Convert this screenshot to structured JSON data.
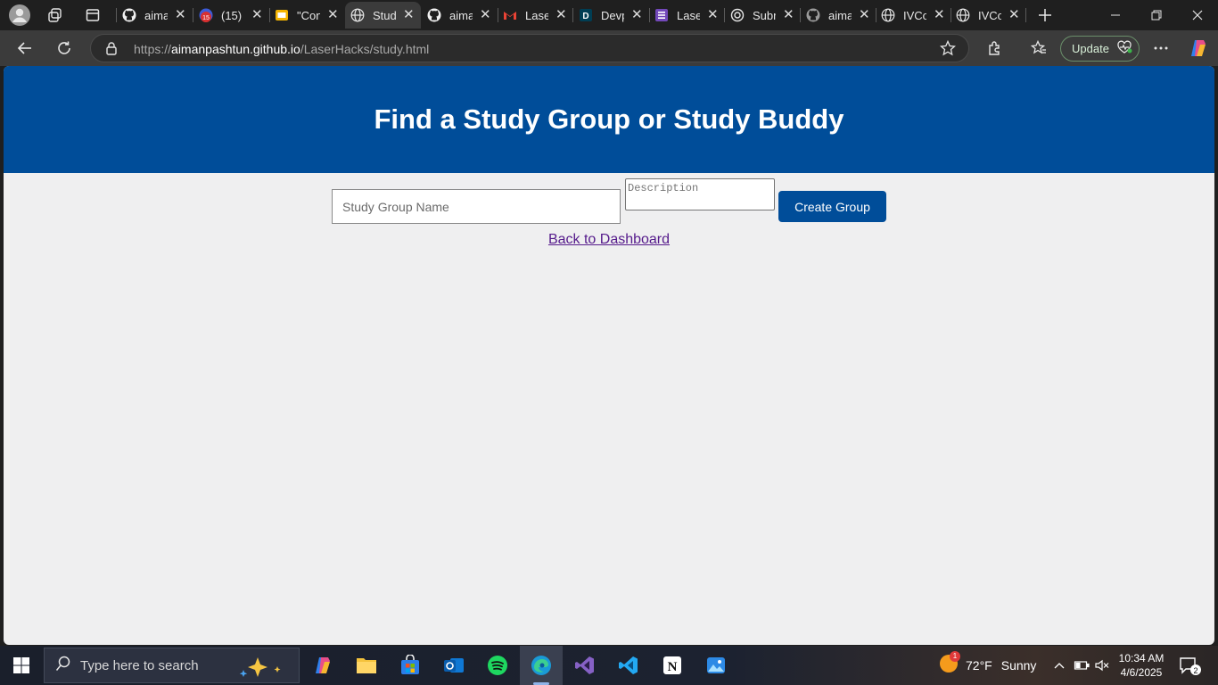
{
  "tabs": [
    {
      "title": "aiman",
      "icon": "github-icon"
    },
    {
      "title": "(15)",
      "icon": "notification-badge-icon",
      "badge": "15"
    },
    {
      "title": "\"Con",
      "icon": "slides-icon"
    },
    {
      "title": "Stud",
      "icon": "globe-icon",
      "active": true
    },
    {
      "title": "aiman",
      "icon": "github-icon"
    },
    {
      "title": "Laser",
      "icon": "gmail-icon"
    },
    {
      "title": "Devp",
      "icon": "devpost-icon"
    },
    {
      "title": "Laser",
      "icon": "forms-icon"
    },
    {
      "title": "Subr",
      "icon": "openai-icon"
    },
    {
      "title": "aiman",
      "icon": "github-icon"
    },
    {
      "title": "IVCo",
      "icon": "globe-icon"
    },
    {
      "title": "IVCo",
      "icon": "globe-icon"
    }
  ],
  "address": {
    "scheme": "https://",
    "domain": "aimanpashtun.github.io",
    "path": "/LaserHacks/study.html"
  },
  "update_label": "Update",
  "page": {
    "title": "Find a Study Group or Study Buddy",
    "group_name_placeholder": "Study Group Name",
    "description_placeholder": "Description",
    "create_button": "Create Group",
    "back_link": "Back to Dashboard",
    "header_color": "#004d99",
    "link_color": "#551a8b"
  },
  "taskbar": {
    "search_placeholder": "Type here to search",
    "weather_temp": "72°F",
    "weather_text": "Sunny",
    "time": "10:34 AM",
    "date": "4/6/2025",
    "notification_count": "2",
    "weather_badge": "1"
  }
}
